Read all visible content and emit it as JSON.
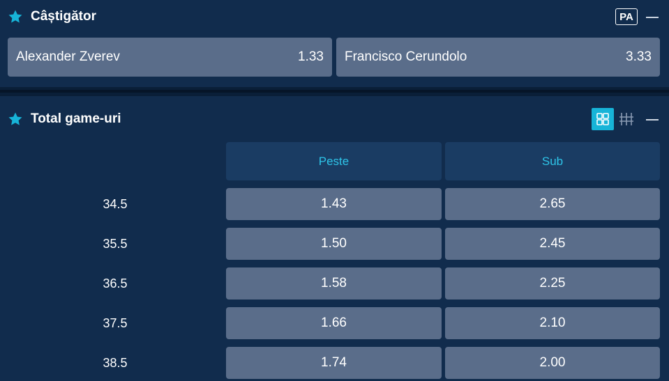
{
  "winner_section": {
    "title": "Câștigător",
    "badge": "PA",
    "options": [
      {
        "name": "Alexander Zverev",
        "odd": "1.33"
      },
      {
        "name": "Francisco Cerundolo",
        "odd": "3.33"
      }
    ]
  },
  "total_games_section": {
    "title": "Total game-uri",
    "columns": [
      "Peste",
      "Sub"
    ],
    "rows": [
      {
        "line": "34.5",
        "over": "1.43",
        "under": "2.65"
      },
      {
        "line": "35.5",
        "over": "1.50",
        "under": "2.45"
      },
      {
        "line": "36.5",
        "over": "1.58",
        "under": "2.25"
      },
      {
        "line": "37.5",
        "over": "1.66",
        "under": "2.10"
      },
      {
        "line": "38.5",
        "over": "1.74",
        "under": "2.00"
      }
    ]
  },
  "icons": {
    "favorite": "star-icon",
    "collapse": "minus-icon",
    "grid_view": "grid-view-icon",
    "list_view": "list-view-icon"
  },
  "colors": {
    "background": "#112c4d",
    "accent": "#17b4d8",
    "odd_button": "#5a6d8a",
    "column_header": "#1a3c63",
    "column_header_text": "#2ec4e8"
  }
}
